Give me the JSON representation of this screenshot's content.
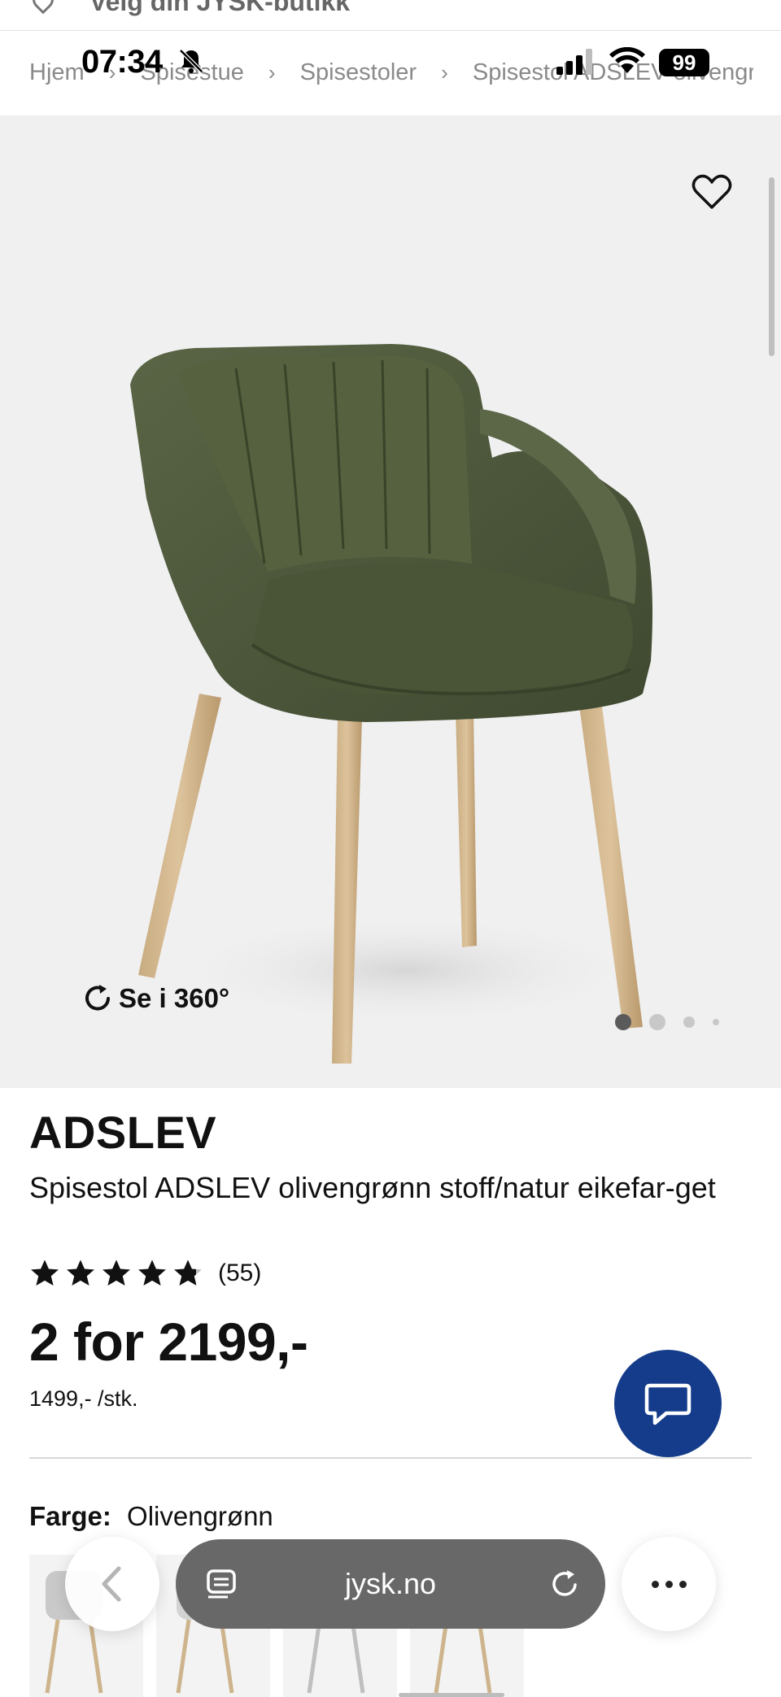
{
  "status_bar": {
    "time": "07:34",
    "battery": "99"
  },
  "store_bar": {
    "label": "Velg din JYSK-butikk"
  },
  "breadcrumb": {
    "items": [
      "Hjem",
      "Spisestue",
      "Spisestoler",
      "Spisestol ADSLEV olivengrønn"
    ],
    "separator": "›"
  },
  "gallery": {
    "view360_label": "Se i 360°",
    "dots": 4,
    "active_dot": 0
  },
  "product": {
    "brand": "ADSLEV",
    "name": "Spisestol ADSLEV olivengrønn stoff/natur eikefar-get",
    "rating": 4.8,
    "rating_max": 5,
    "review_count": "(55)",
    "price": "2 for 2199,-",
    "unit_price": "1499,- /stk.",
    "color_label": "Farge:",
    "color_value": "Olivengrønn"
  },
  "colors": {
    "chair_fabric": "#4f5a3d",
    "chair_legs": "#cfb58d",
    "chat_bg": "#143c8a",
    "url_bar_bg": "#686868"
  },
  "browser": {
    "url": "jysk.no"
  }
}
